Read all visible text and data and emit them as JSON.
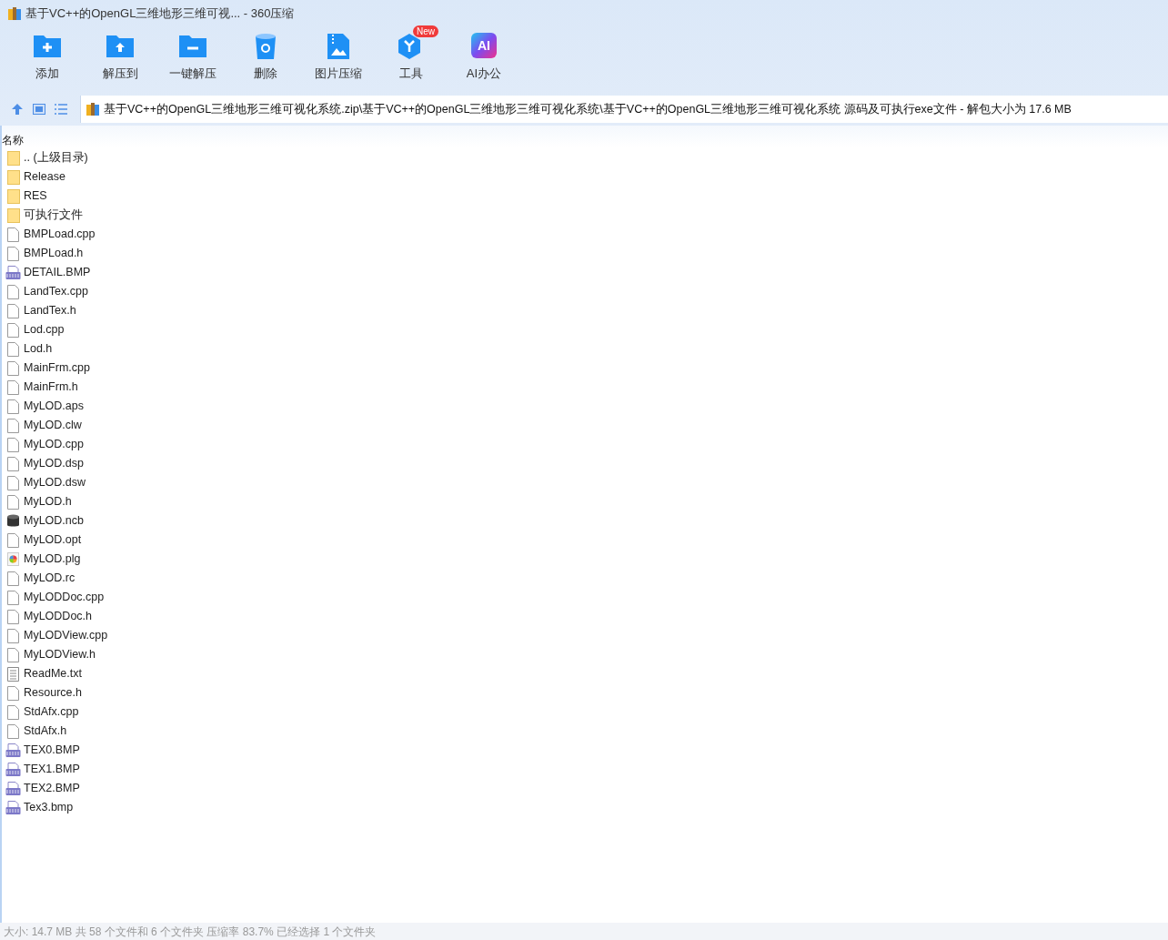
{
  "window": {
    "title": "基于VC++的OpenGL三维地形三维可视... - 360压缩"
  },
  "toolbar": [
    {
      "kind": "add",
      "label": "添加"
    },
    {
      "kind": "extract",
      "label": "解压到"
    },
    {
      "kind": "oneclick",
      "label": "一键解压"
    },
    {
      "kind": "delete",
      "label": "删除"
    },
    {
      "kind": "image",
      "label": "图片压缩"
    },
    {
      "kind": "tools",
      "label": "工具",
      "badge": "New"
    },
    {
      "kind": "ai",
      "label": "AI办公",
      "icon_text": "AI"
    }
  ],
  "address": {
    "path": "基于VC++的OpenGL三维地形三维可视化系统.zip\\基于VC++的OpenGL三维地形三维可视化系统\\基于VC++的OpenGL三维地形三维可视化系统 源码及可执行exe文件 - 解包大小为 17.6 MB"
  },
  "list": {
    "column": "名称",
    "rows": [
      {
        "kind": "folder",
        "name": ".. (上级目录)"
      },
      {
        "kind": "folder",
        "name": "Release"
      },
      {
        "kind": "folder",
        "name": "RES"
      },
      {
        "kind": "folder",
        "name": "可执行文件"
      },
      {
        "kind": "file",
        "name": "BMPLoad.cpp"
      },
      {
        "kind": "file",
        "name": "BMPLoad.h"
      },
      {
        "kind": "bmp",
        "name": "DETAIL.BMP"
      },
      {
        "kind": "file",
        "name": "LandTex.cpp"
      },
      {
        "kind": "file",
        "name": "LandTex.h"
      },
      {
        "kind": "file",
        "name": "Lod.cpp"
      },
      {
        "kind": "file",
        "name": "Lod.h"
      },
      {
        "kind": "file",
        "name": "MainFrm.cpp"
      },
      {
        "kind": "file",
        "name": "MainFrm.h"
      },
      {
        "kind": "file",
        "name": "MyLOD.aps"
      },
      {
        "kind": "file",
        "name": "MyLOD.clw"
      },
      {
        "kind": "file",
        "name": "MyLOD.cpp"
      },
      {
        "kind": "file",
        "name": "MyLOD.dsp"
      },
      {
        "kind": "file",
        "name": "MyLOD.dsw"
      },
      {
        "kind": "file",
        "name": "MyLOD.h"
      },
      {
        "kind": "database",
        "name": "MyLOD.ncb"
      },
      {
        "kind": "file",
        "name": "MyLOD.opt"
      },
      {
        "kind": "color",
        "name": "MyLOD.plg"
      },
      {
        "kind": "file",
        "name": "MyLOD.rc"
      },
      {
        "kind": "file",
        "name": "MyLODDoc.cpp"
      },
      {
        "kind": "file",
        "name": "MyLODDoc.h"
      },
      {
        "kind": "file",
        "name": "MyLODView.cpp"
      },
      {
        "kind": "file",
        "name": "MyLODView.h"
      },
      {
        "kind": "text",
        "name": "ReadMe.txt"
      },
      {
        "kind": "file",
        "name": "Resource.h"
      },
      {
        "kind": "file",
        "name": "StdAfx.cpp"
      },
      {
        "kind": "file",
        "name": "StdAfx.h"
      },
      {
        "kind": "bmp",
        "name": "TEX0.BMP"
      },
      {
        "kind": "bmp",
        "name": "TEX1.BMP"
      },
      {
        "kind": "bmp",
        "name": "TEX2.BMP"
      },
      {
        "kind": "bmp",
        "name": "Tex3.bmp"
      }
    ]
  },
  "status_bar": "大小: 14.7 MB 共 58 个文件和 6 个文件夹 压缩率 83.7% 已经选择 1 个文件夹"
}
